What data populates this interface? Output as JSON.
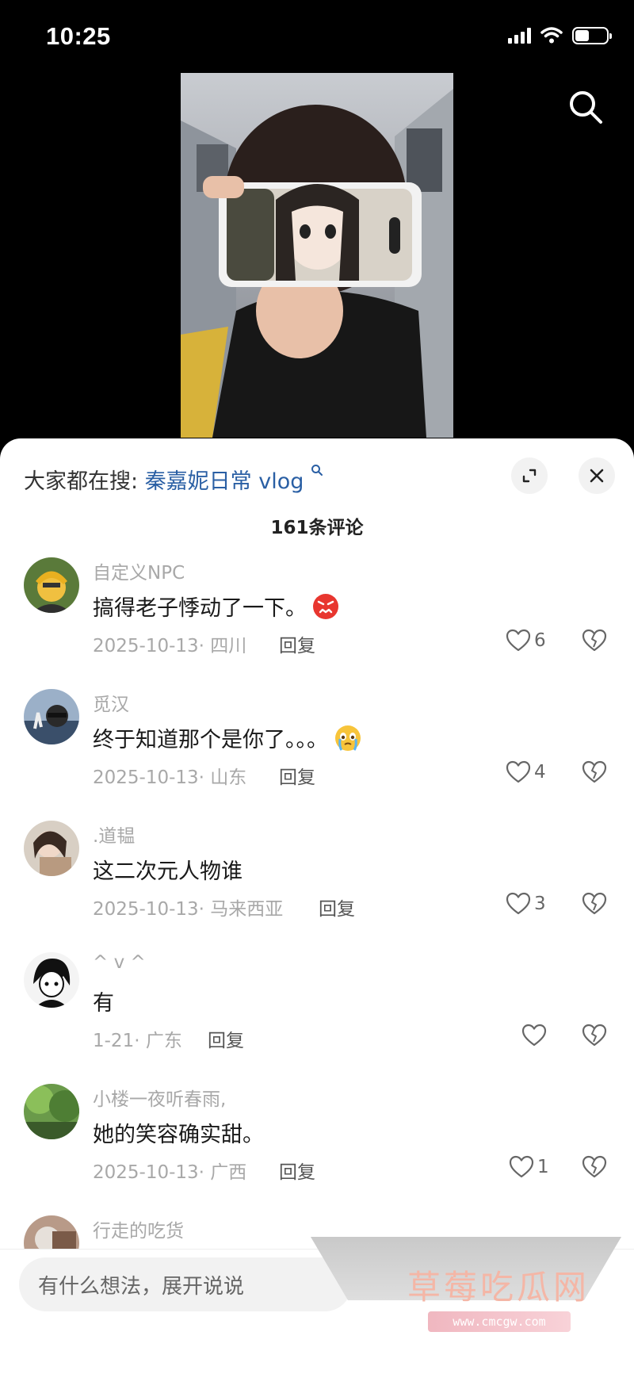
{
  "status_bar": {
    "time": "10:25",
    "battery_level": 0.45
  },
  "hot_search": {
    "label": "大家都在搜: ",
    "term": "秦嘉妮日常 vlog"
  },
  "comment_count": "161条评论",
  "comments": [
    {
      "username": "自定义NPC",
      "text": "搞得老子悸动了一下。",
      "emoji": "angry-face-emoji",
      "date": "2025-10-13",
      "location": "四川",
      "reply": "回复",
      "likes": "6"
    },
    {
      "username": "觅汉",
      "text": "终于知道那个是你了。。。",
      "emoji": "crying-face-emoji",
      "date": "2025-10-13",
      "location": "山东",
      "reply": "回复",
      "likes": "4"
    },
    {
      "username": ".道韫",
      "text": "这二次元人物谁",
      "date": "2025-10-13",
      "location": "马来西亚",
      "reply": "回复",
      "likes": "3"
    },
    {
      "username": "^ v ^",
      "text": "有",
      "date": "1-21",
      "location": "广东",
      "reply": "回复",
      "likes": ""
    },
    {
      "username": "小楼一夜听春雨,",
      "text": "她的笑容确实甜。",
      "date": "2025-10-13",
      "location": "广西",
      "reply": "回复",
      "likes": "1"
    },
    {
      "username": "行走的吃货"
    }
  ],
  "input": {
    "placeholder": "有什么想法，展开说说"
  },
  "watermark": {
    "text": "草莓吃瓜网",
    "url": "www.cmcgw.com"
  },
  "colors": {
    "link": "#2a5fa4",
    "muted": "#a8a8a8",
    "sheet": "#ffffff"
  }
}
